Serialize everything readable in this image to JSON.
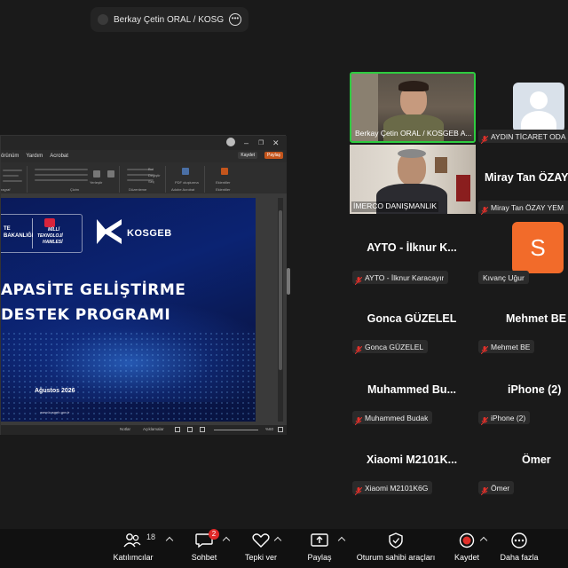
{
  "share_banner": {
    "title": "Berkay Çetin ORAL / KOSGEB AYD"
  },
  "screen": {
    "menu": [
      "örünüm",
      "Yardım",
      "Acrobat"
    ],
    "kaydet": "Kaydet",
    "paylas": "Paylaş",
    "ribbon_groups": [
      "ragraf",
      "Çizim",
      "Düzenleme",
      "Adobe Acrobat",
      "Eklentiler"
    ],
    "ribbon_labels": [
      "Yerleştir",
      "Bul",
      "Değiştir",
      "Seç",
      "PDF oluşturma",
      "Eklentiler"
    ],
    "slide": {
      "ministry": "TE\nBAKANLIĞI",
      "mtf_line1": "MİLLİ",
      "mtf_line2": "TEKNOLOJİ",
      "mtf_line3": "HAMLESİ",
      "kosgeb": "KOSGEB",
      "title_line1": "APASİTE GELİŞTİRME",
      "title_line2": "DESTEK PROGRAMI",
      "date": "Ağustos 2026",
      "url": "www.kosgeb.gov.tr"
    },
    "status": {
      "notlar": "Notlar",
      "aciklamalar": "Açıklamalar",
      "zoom": "%60"
    }
  },
  "participants": [
    {
      "id": "berkay",
      "kind": "video",
      "label": "Berkay Çetin ORAL / KOSGEB A..."
    },
    {
      "id": "aydin",
      "kind": "avatar",
      "label": "AYDIN TİCARET ODASI"
    },
    {
      "id": "imerco",
      "kind": "video",
      "label": "İMERCO DANIŞMANLIK"
    },
    {
      "id": "miray",
      "kind": "name",
      "big": "Miray Tan ÖZAY",
      "label": "Miray Tan ÖZAY YEM"
    },
    {
      "id": "ayto",
      "kind": "name",
      "big": "AYTO - İlknur K...",
      "label": "AYTO - İlknur Karacayır"
    },
    {
      "id": "kivanc",
      "kind": "letter",
      "letter": "S",
      "label": "Kıvanç Uğur"
    },
    {
      "id": "gonca",
      "kind": "name",
      "big": "Gonca GÜZELEL",
      "label": "Gonca GÜZELEL"
    },
    {
      "id": "mehmet",
      "kind": "name",
      "big": "Mehmet BE",
      "label": "Mehmet BE"
    },
    {
      "id": "muhammed",
      "kind": "name",
      "big": "Muhammed Bu...",
      "label": "Muhammed Budak"
    },
    {
      "id": "iphone",
      "kind": "name",
      "big": "iPhone (2)",
      "label": "iPhone (2)"
    },
    {
      "id": "xiaomi",
      "kind": "name",
      "big": "Xiaomi M2101K...",
      "label": "Xiaomi M2101K6G"
    },
    {
      "id": "omer",
      "kind": "name",
      "big": "Ömer",
      "label": "Ömer"
    }
  ],
  "toolbar": {
    "participants_count": "18",
    "participants": "Katılımcılar",
    "chat_badge": "2",
    "chat": "Sohbet",
    "react": "Tepki ver",
    "share": "Paylaş",
    "host_tools": "Oturum sahibi araçları",
    "record": "Kaydet",
    "more": "Daha fazla"
  },
  "colors": {
    "active_speaker_border": "#2ecc40",
    "mic_muted": "#e0302a",
    "letter_avatar": "#f26b2a",
    "record": "#e0302a"
  }
}
